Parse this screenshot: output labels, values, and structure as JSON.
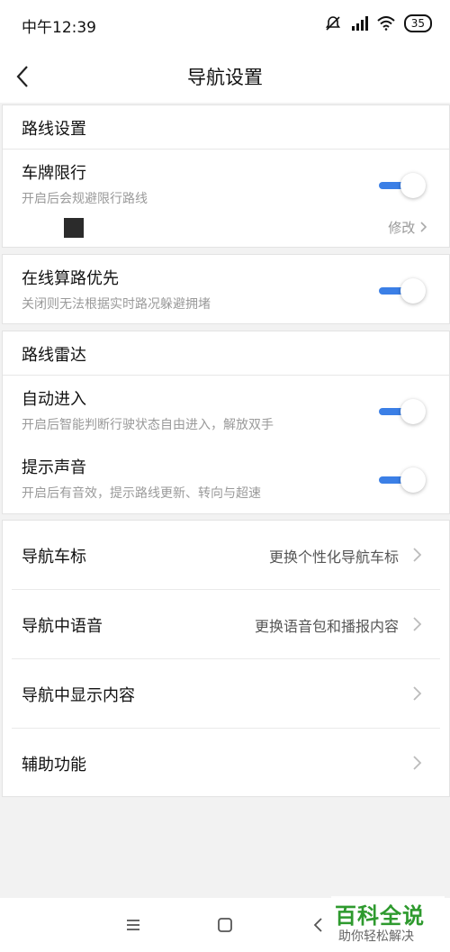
{
  "status_bar": {
    "time": "中午12:39",
    "battery": "35",
    "icons": [
      "mute-icon",
      "hd-signal-icon",
      "wifi-icon",
      "battery-icon"
    ]
  },
  "header": {
    "title": "导航设置"
  },
  "route_settings": {
    "section_title": "路线设置",
    "plate_limit": {
      "title": "车牌限行",
      "subtitle": "开启后会规避限行路线",
      "enabled": true,
      "modify_label": "修改"
    }
  },
  "online_priority": {
    "title": "在线算路优先",
    "subtitle": "关闭则无法根据实时路况躲避拥堵",
    "enabled": true
  },
  "route_radar": {
    "section_title": "路线雷达",
    "items": [
      {
        "title": "自动进入",
        "subtitle": "开启后智能判断行驶状态自由进入，解放双手",
        "enabled": true
      },
      {
        "title": "提示声音",
        "subtitle": "开启后有音效，提示路线更新、转向与超速",
        "enabled": true
      }
    ]
  },
  "nav_list": [
    {
      "title": "导航车标",
      "desc": "更换个性化导航车标"
    },
    {
      "title": "导航中语音",
      "desc": "更换语音包和播报内容"
    },
    {
      "title": "导航中显示内容",
      "desc": ""
    },
    {
      "title": "辅助功能",
      "desc": ""
    }
  ],
  "watermark": {
    "title": "百科全说",
    "subtitle": "助你轻松解决"
  },
  "colors": {
    "accent": "#3b7fe6",
    "background": "#f2f2f2",
    "watermark_green": "#2e9a2e"
  }
}
